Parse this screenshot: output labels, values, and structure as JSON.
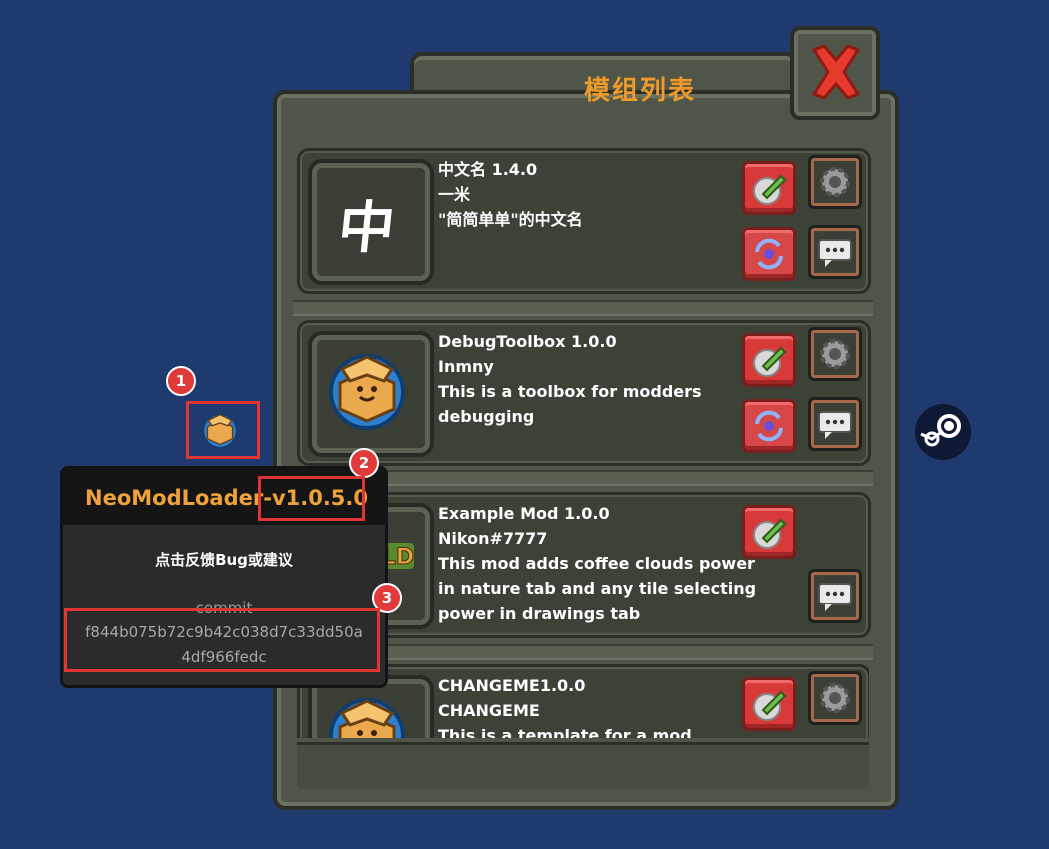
{
  "window": {
    "title": "模组列表",
    "close_icon": "close-x-icon"
  },
  "mods": [
    {
      "icon": "chinese-character-icon",
      "icon_glyph": "中",
      "name_version": "中文名   1.4.0",
      "author": "一米",
      "description_lines": [
        "\"简简单单\"的中文名"
      ],
      "buttons": [
        "edit",
        "settings",
        "reload",
        "chat"
      ]
    },
    {
      "icon": "open-mods-box-icon",
      "name_version": "DebugToolbox 1.0.0",
      "author": "Inmny",
      "description_lines": [
        "This is a toolbox for modders",
        "debugging"
      ],
      "buttons": [
        "edit",
        "settings",
        "reload",
        "chat"
      ]
    },
    {
      "icon": "worldbox-logo-icon",
      "name_version": "Example Mod   1.0.0",
      "author": "Nikon#7777",
      "description_lines": [
        "This mod adds coffee clouds power",
        "in nature tab and any tile selecting",
        "power in drawings tab"
      ],
      "buttons": [
        "edit",
        "chat"
      ]
    },
    {
      "icon": "open-mods-box-icon",
      "name_version": "CHANGEME1.0.0",
      "author": "CHANGEME",
      "description_lines": [
        "This is a template for a mod"
      ],
      "buttons": [
        "edit",
        "settings"
      ]
    }
  ],
  "tooltip": {
    "title_name": "NeoModLoader-",
    "title_version": "v1.0.5.0",
    "feedback": "点击反馈Bug或建议",
    "commit_label": "commit",
    "commit_hash_line1": "f844b075b72c9b42c038d7c33dd50a",
    "commit_hash_line2": "4df966fedc"
  },
  "annotations": [
    "1",
    "2",
    "3"
  ],
  "steam_icon": "steam-icon",
  "colors": {
    "background": "#1e3a6f",
    "title": "#ef9a2a",
    "button_red": "#d83a3a",
    "annotation_red": "#e03535"
  }
}
